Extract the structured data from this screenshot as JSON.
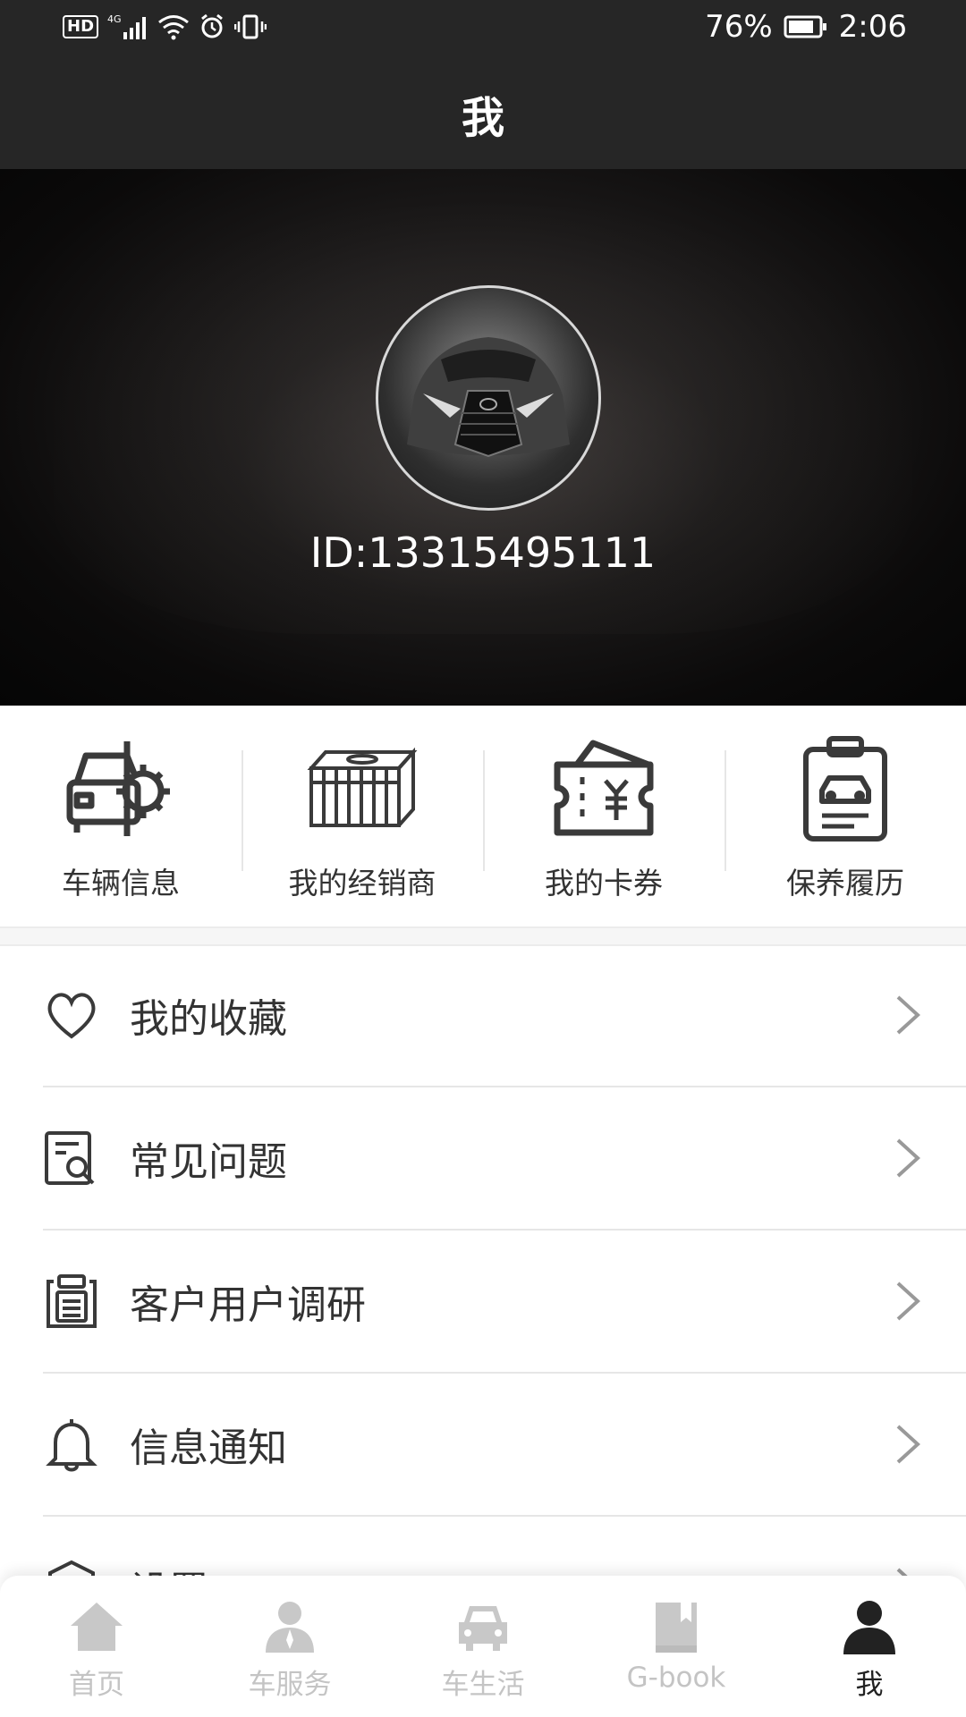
{
  "status_bar": {
    "hd": "HD",
    "network": "4G",
    "battery": "76%",
    "time": "2:06"
  },
  "header": {
    "title": "我"
  },
  "profile": {
    "id_text": "ID:13315495111"
  },
  "shortcuts": [
    {
      "label": "车辆信息",
      "icon": "car-gear-icon"
    },
    {
      "label": "我的经销商",
      "icon": "dealership-building-icon"
    },
    {
      "label": "我的卡券",
      "icon": "coupon-wallet-icon"
    },
    {
      "label": "保养履历",
      "icon": "maintenance-clipboard-icon"
    }
  ],
  "menu": [
    {
      "label": "我的收藏",
      "icon": "heart-icon"
    },
    {
      "label": "常见问题",
      "icon": "document-search-icon"
    },
    {
      "label": "客户用户调研",
      "icon": "clipboard-list-icon"
    },
    {
      "label": "信息通知",
      "icon": "bell-icon"
    },
    {
      "label": "设置",
      "icon": "settings-icon"
    }
  ],
  "tabbar": [
    {
      "label": "首页",
      "icon": "home-icon",
      "active": false
    },
    {
      "label": "车服务",
      "icon": "service-person-icon",
      "active": false
    },
    {
      "label": "车生活",
      "icon": "car-icon",
      "active": false
    },
    {
      "label": "G-book",
      "icon": "book-icon",
      "active": false
    },
    {
      "label": "我",
      "icon": "user-icon",
      "active": true
    }
  ],
  "colors": {
    "header_bg": "#262626",
    "text": "#333333",
    "tab_inactive": "#c4c4c4",
    "tab_active": "#222222"
  }
}
